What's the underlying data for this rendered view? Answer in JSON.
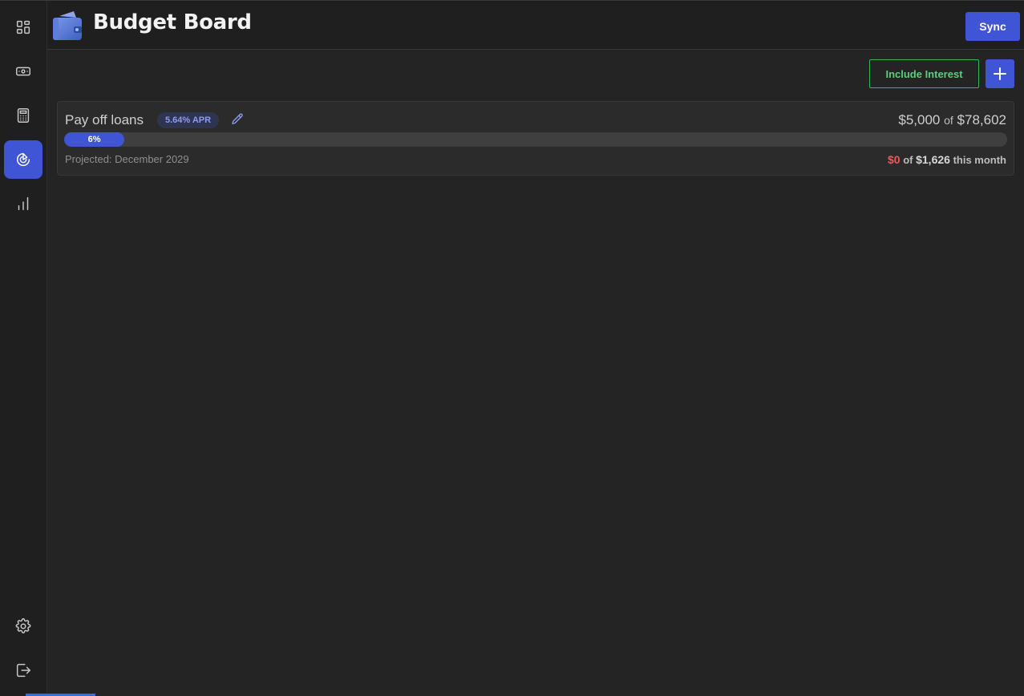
{
  "app": {
    "title": "Budget Board",
    "sync_label": "Sync"
  },
  "sidebar": {
    "items": [
      {
        "icon": "dashboard-icon",
        "active": false
      },
      {
        "icon": "money-icon",
        "active": false
      },
      {
        "icon": "calculator-icon",
        "active": false
      },
      {
        "icon": "goals-icon",
        "active": true
      },
      {
        "icon": "chart-icon",
        "active": false
      }
    ],
    "bottom": [
      {
        "icon": "gear-icon"
      },
      {
        "icon": "logout-icon"
      }
    ]
  },
  "toolbar": {
    "include_interest_label": "Include Interest",
    "add_icon": "plus-icon"
  },
  "goals": [
    {
      "name": "Pay off loans",
      "apr_badge": "5.64% APR",
      "current": "$5,000",
      "of": "of",
      "target": "$78,602",
      "progress_label": "6%",
      "progress_fraction": 0.064,
      "projected": "Projected: December 2029",
      "month_spent": "$0",
      "month_of": "of",
      "month_target": "$1,626",
      "month_suffix": "this month"
    }
  ],
  "colors": {
    "accent": "#4055d6",
    "success": "#5ccf79",
    "danger": "#e85a5a",
    "background": "#242424"
  }
}
